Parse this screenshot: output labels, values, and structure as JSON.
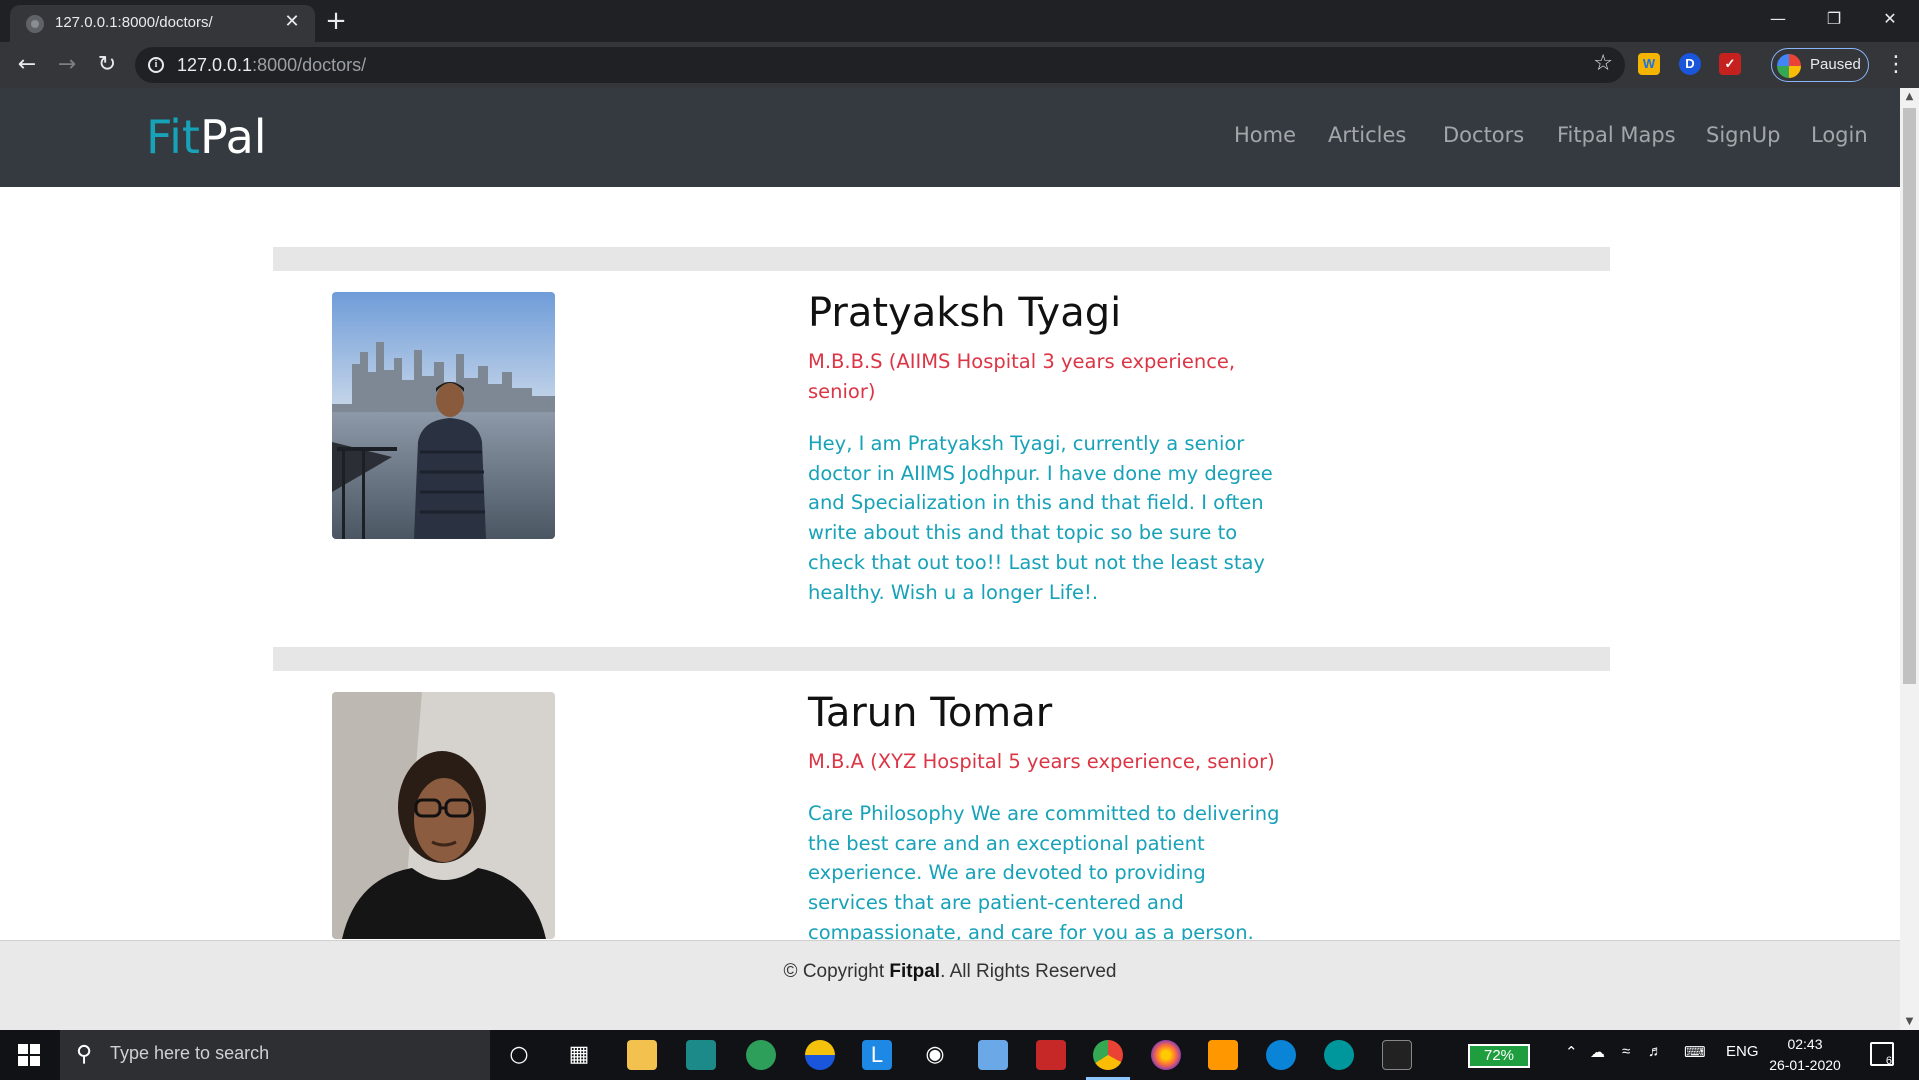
{
  "browser": {
    "tab_title": "127.0.0.1:8000/doctors/",
    "url_host": "127.0.0.1",
    "url_rest": ":8000/doctors/",
    "profile_label": "Paused",
    "new_tab_symbol": "+",
    "close_tab_symbol": "✕"
  },
  "site": {
    "logo_fit": "Fit",
    "logo_pal": "Pal",
    "nav": [
      "Home",
      "Articles",
      "Doctors",
      "Fitpal Maps",
      "SignUp",
      "Login"
    ]
  },
  "doctors": [
    {
      "name": "Pratyaksh Tyagi",
      "qualification": "M.B.B.S (AIIMS Hospital 3 years experience, senior)",
      "description": "Hey, I am Pratyaksh Tyagi, currently a senior doctor in AIIMS Jodhpur. I have done my degree and Specialization in this and that field. I often write about this and that topic so be sure to check that out too!! Last but not the least stay healthy. Wish u a longer Life!."
    },
    {
      "name": "Tarun Tomar",
      "qualification": "M.B.A (XYZ Hospital 5 years experience, senior)",
      "description": "Care Philosophy We are committed to delivering the best care and an exceptional patient experience. We are devoted to providing services that are patient-centered and compassionate, and care for you as a person. Specialties - Cardiology"
    }
  ],
  "footer": {
    "prefix": "© Copyright ",
    "brand": "Fitpal",
    "suffix": ". All Rights Reserved"
  },
  "taskbar": {
    "search_placeholder": "Type here to search",
    "battery": "72%",
    "language": "ENG",
    "time": "02:43",
    "date": "26-01-2020",
    "notification_count": "6"
  },
  "colors": {
    "nav_bg": "#343a40",
    "accent_teal": "#17a2b8",
    "accent_red": "#dc3545"
  }
}
